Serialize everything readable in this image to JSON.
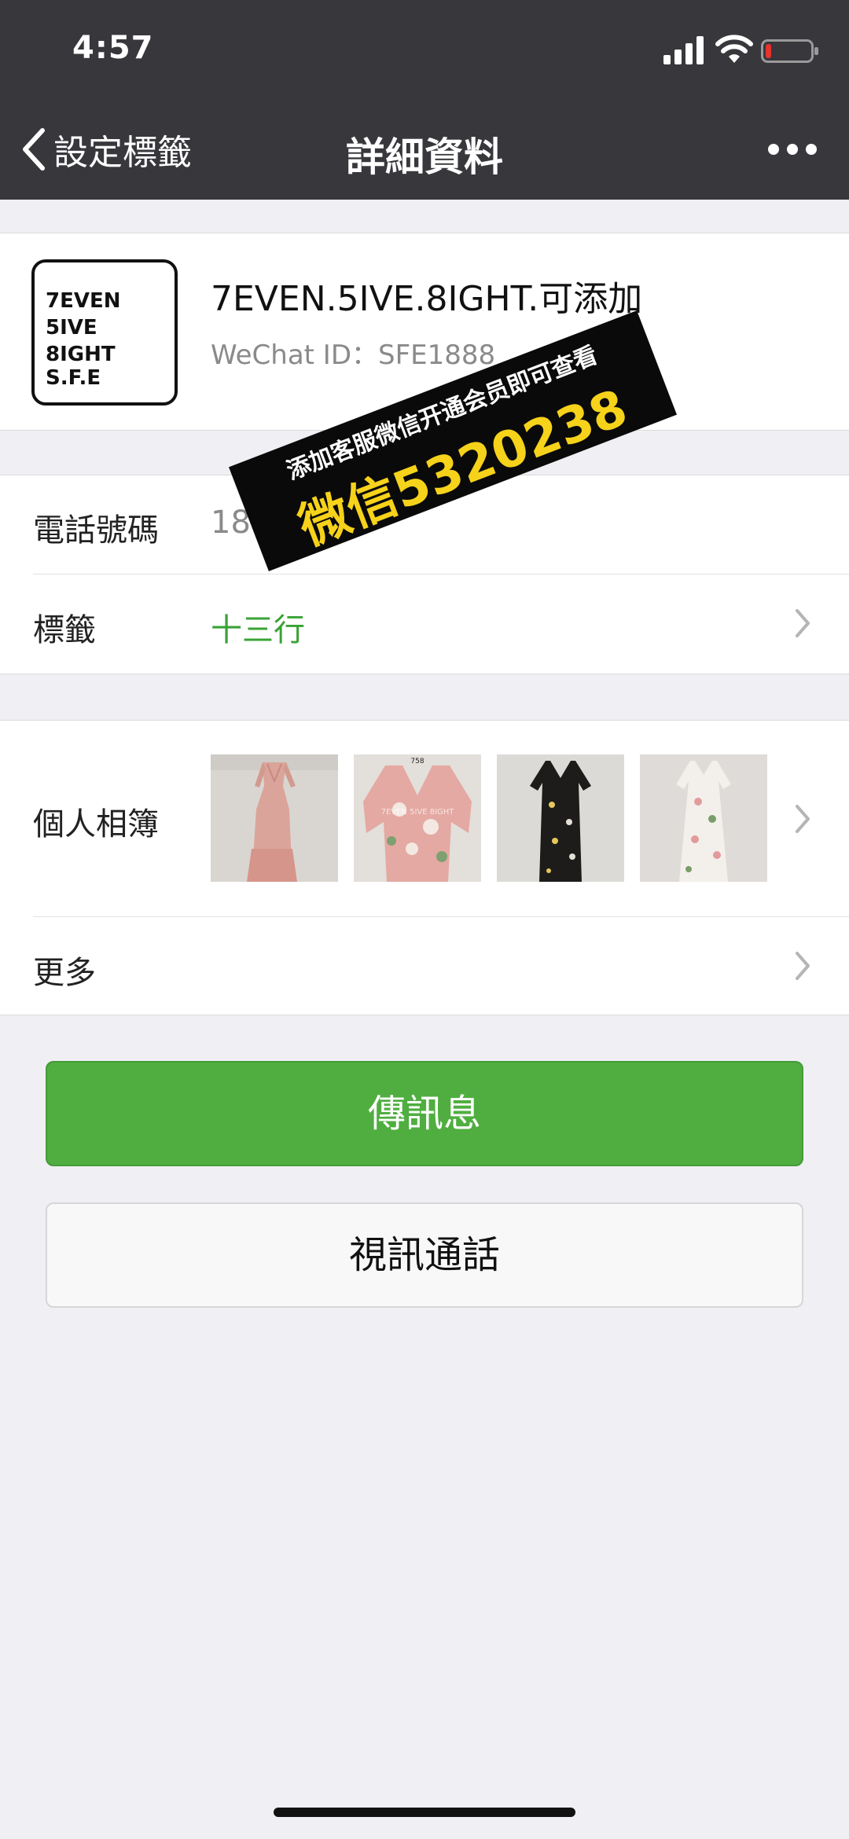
{
  "status_bar": {
    "time": "4:57"
  },
  "nav": {
    "back_label": "設定標籤",
    "title": "詳細資料"
  },
  "profile": {
    "avatar_lines": [
      "7EVEN",
      "5IVE",
      "8IGHT S.F.E"
    ],
    "name": "7EVEN.5IVE.8IGHT.可添加",
    "wechat_id": "WeChat ID：SFE1888"
  },
  "info_rows": {
    "phone_label": "電話號碼",
    "phone_value": "188 63",
    "tag_label": "標籤",
    "tag_value": "十三行"
  },
  "album": {
    "label": "個人相簿",
    "photos": [
      "pink-dress-photo",
      "pink-floral-top-photo",
      "black-floral-dress-photo",
      "white-floral-dress-photo"
    ],
    "photo_text": "758"
  },
  "more": {
    "label": "更多"
  },
  "actions": {
    "message": "傳訊息",
    "video_call": "視訊通話"
  },
  "watermark": {
    "line1": "添加客服微信开通会员即可查看",
    "line2": "微信5320238"
  },
  "colors": {
    "accent_green": "#4fae3f",
    "tag_green": "#3aa336",
    "header_bg": "#38373c",
    "watermark_yellow": "#f6d21a"
  }
}
